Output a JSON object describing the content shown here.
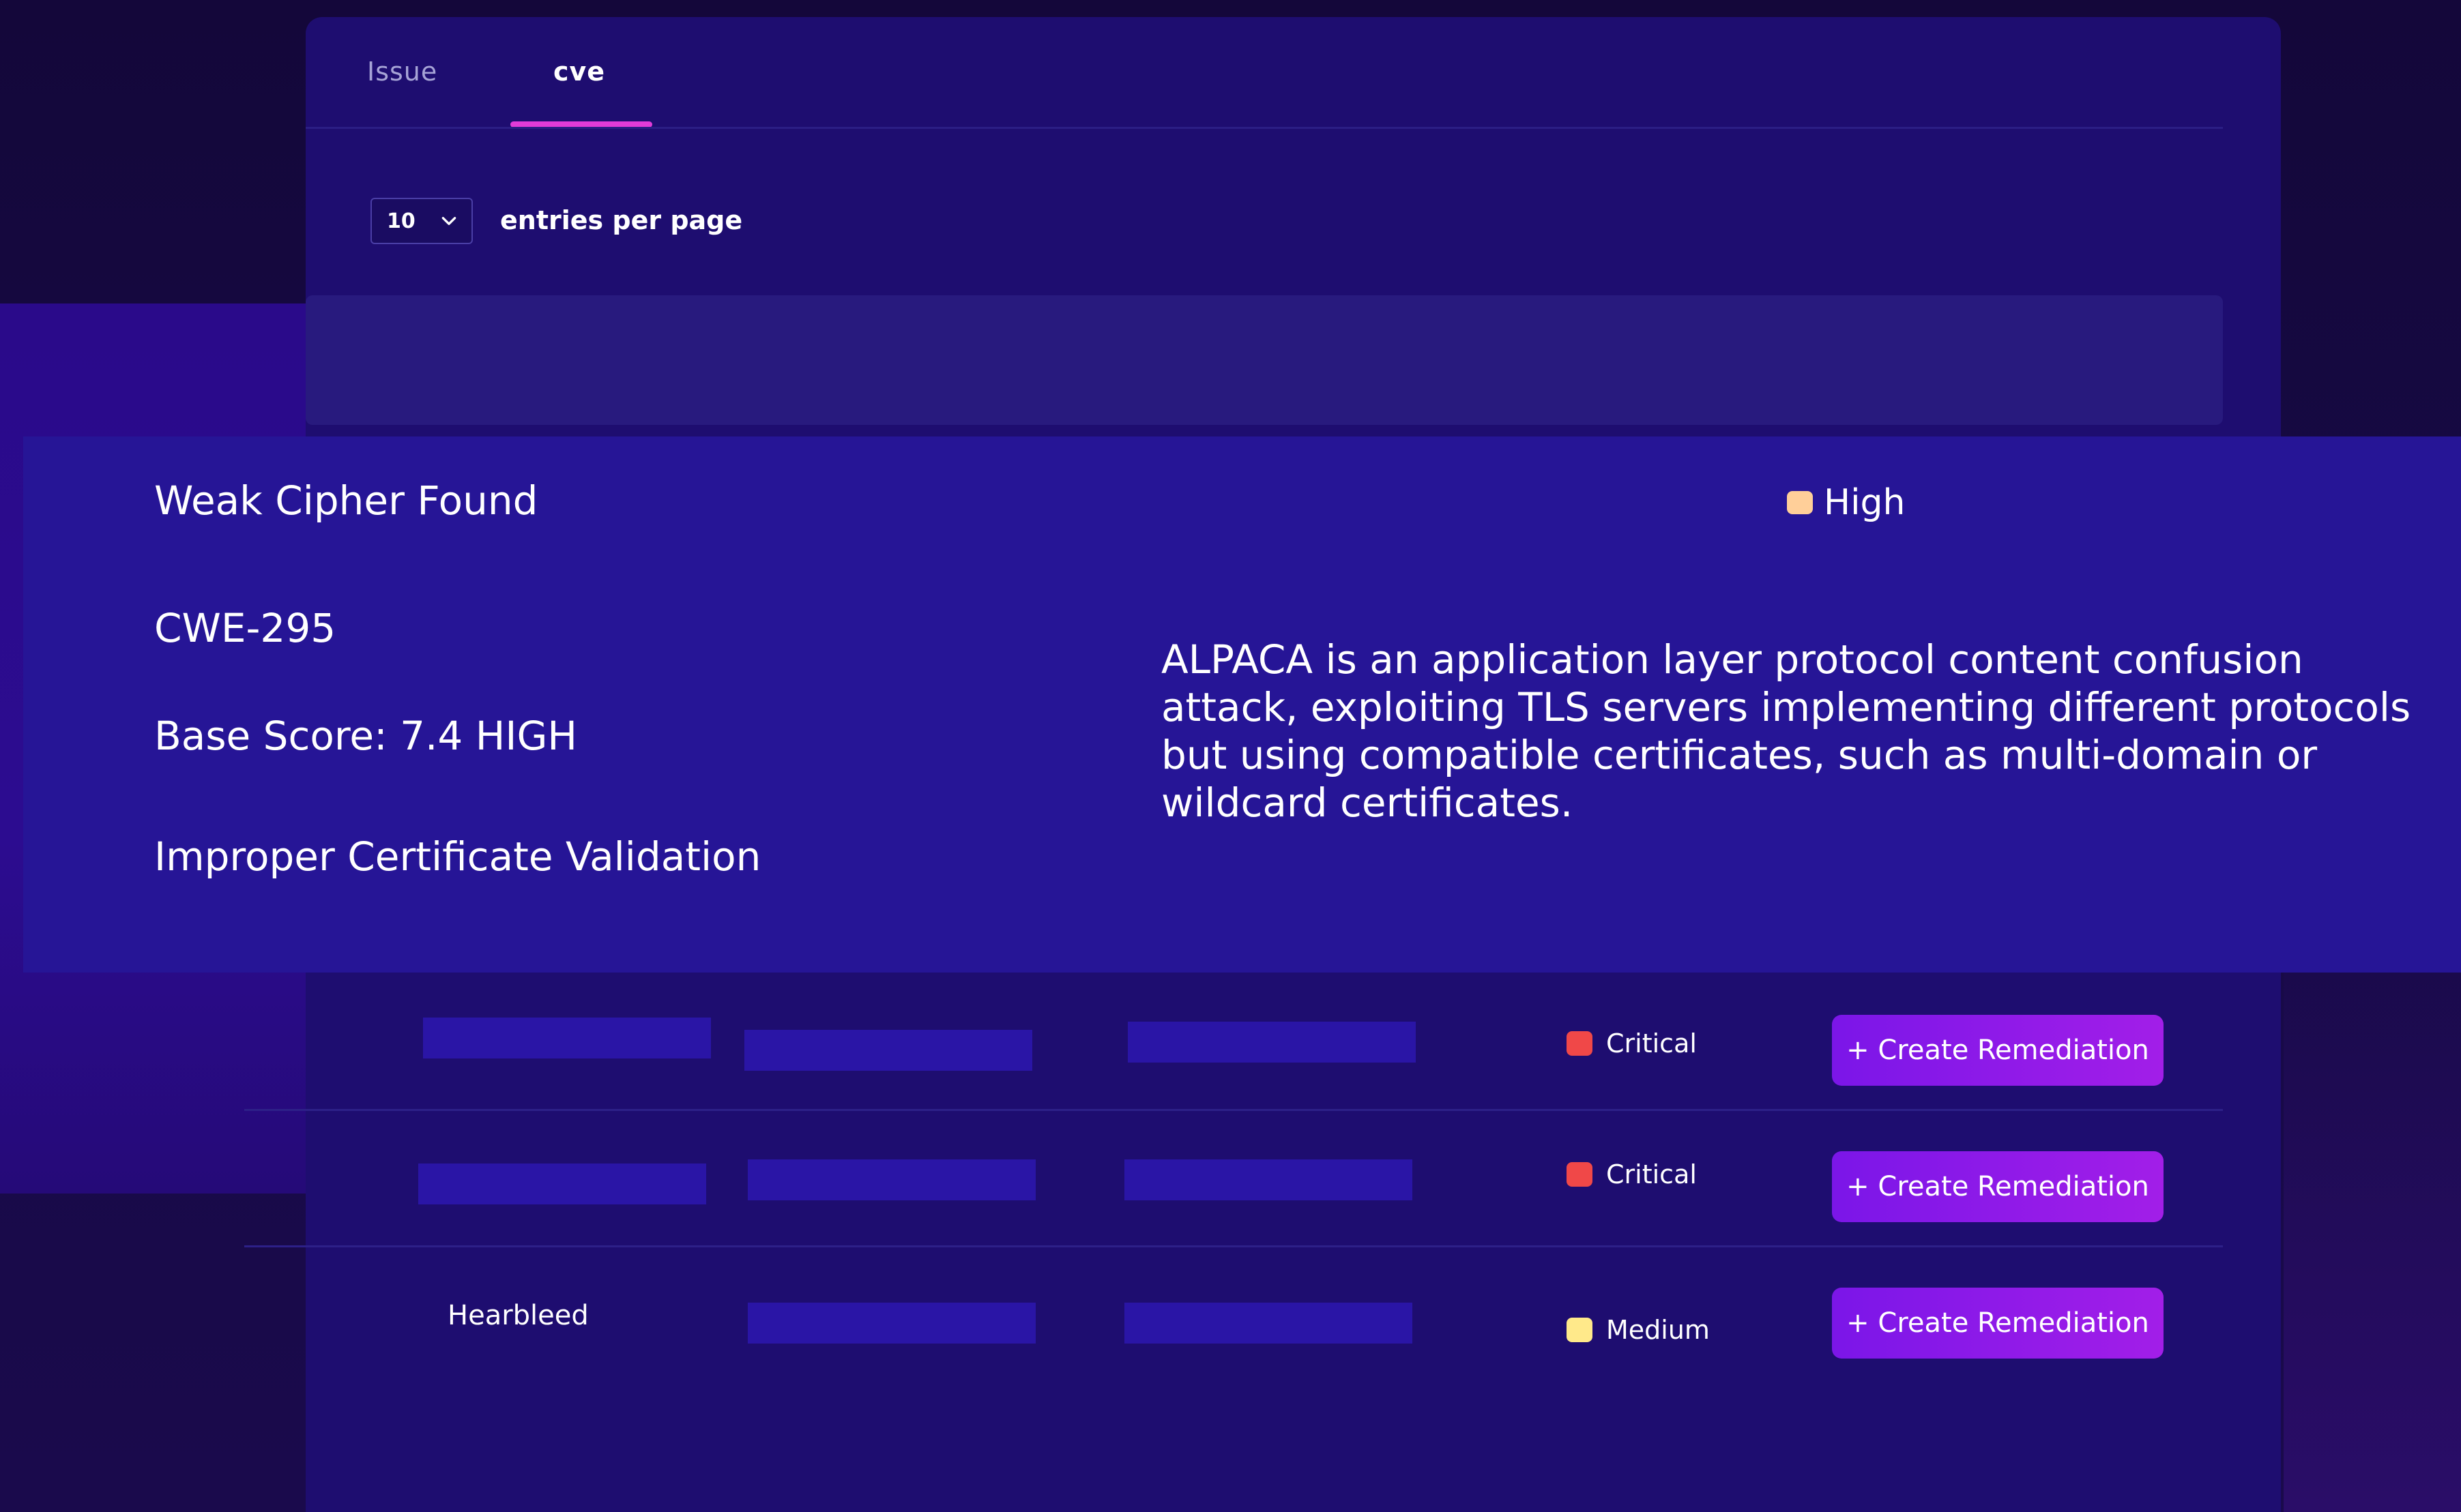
{
  "tabs": [
    {
      "label": "Issue",
      "active": false
    },
    {
      "label": "cve",
      "active": true
    }
  ],
  "pagination": {
    "entries_value": "10",
    "entries_label": "entries per page"
  },
  "detail": {
    "title": "Weak Cipher Found",
    "severity": "High",
    "cwe": "CWE-295",
    "base_score": "Base Score: 7.4 HIGH",
    "weakness": "Improper Certificate Validation",
    "description": "ALPACA is an application layer protocol content confusion attack, exploiting TLS servers implementing different protocols but using compatible certificates, such as multi-domain or wildcard certificates."
  },
  "rows": [
    {
      "name": "",
      "severity": "Critical",
      "action": "+ Create Remediation"
    },
    {
      "name": "",
      "severity": "Critical",
      "action": "+ Create Remediation"
    },
    {
      "name": "Hearbleed",
      "severity": "Medium",
      "action": "+ Create Remediation"
    }
  ],
  "colors": {
    "accent": "#e23bd8",
    "button": "#8a18e8",
    "critical": "#f04848",
    "high": "#ffcf99",
    "medium": "#ffe98a"
  }
}
